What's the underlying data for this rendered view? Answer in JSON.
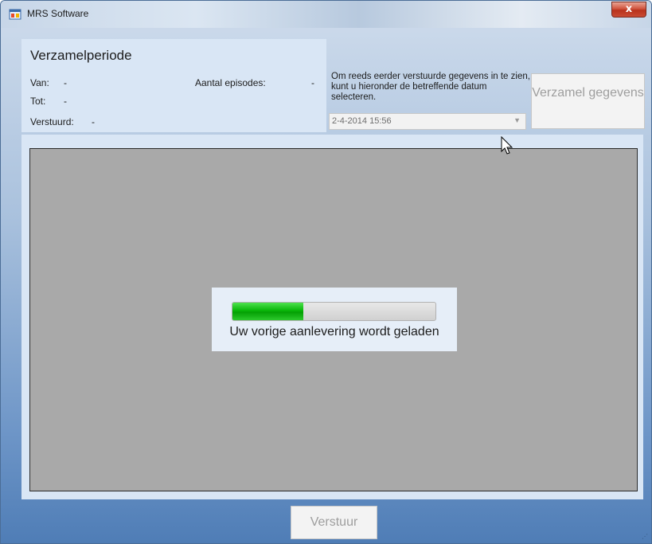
{
  "window": {
    "title": "MRS Software",
    "close_label": "x"
  },
  "period": {
    "heading": "Verzamelperiode",
    "van_label": "Van:",
    "van_value": "-",
    "tot_label": "Tot:",
    "tot_value": "-",
    "verstuurd_label": "Verstuurd:",
    "verstuurd_value": "-",
    "episodes_label": "Aantal episodes:",
    "episodes_value": "-"
  },
  "history": {
    "info": "Om reeds eerder verstuurde gegevens in te zien, kunt u hieronder de betreffende datum selecteren.",
    "selected_date": "2-4-2014 15:56",
    "collect_button": "Verzamel gegevens"
  },
  "loader": {
    "message": "Uw vorige aanlevering wordt geladen",
    "progress_percent": 35
  },
  "footer": {
    "send_button": "Verstuur"
  },
  "colors": {
    "progress_green": "#09b609",
    "panel_bg": "#d9e6f5",
    "content_gray": "#a9a9a9"
  }
}
